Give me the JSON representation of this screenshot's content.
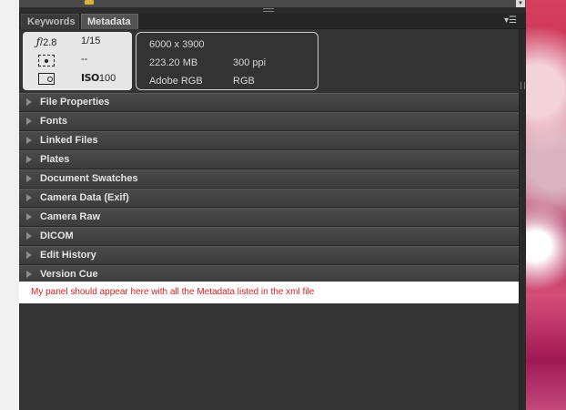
{
  "tabs": [
    {
      "label": "Keywords"
    },
    {
      "label": "Metadata"
    }
  ],
  "panel_menu_icon": "panel-menu",
  "camera": {
    "aperture_symbol": "ƒ",
    "aperture_value": "/2.8",
    "shutter": "1/15",
    "metering": "--",
    "iso_symbol": "ISO",
    "iso_value": "100"
  },
  "file_info": {
    "dimensions": "6000 x 3900",
    "size": "223.20 MB",
    "resolution": "300 ppi",
    "profile": "Adobe RGB",
    "mode": "RGB"
  },
  "sections": [
    "File Properties",
    "Fonts",
    "Linked Files",
    "Plates",
    "Document Swatches",
    "Camera Data (Exif)",
    "Camera Raw",
    "DICOM",
    "Edit History",
    "Version Cue"
  ],
  "custom_panel": {
    "message": "My panel should appear here with all the Metadata listed in the xml file",
    "color": "#e02020"
  }
}
